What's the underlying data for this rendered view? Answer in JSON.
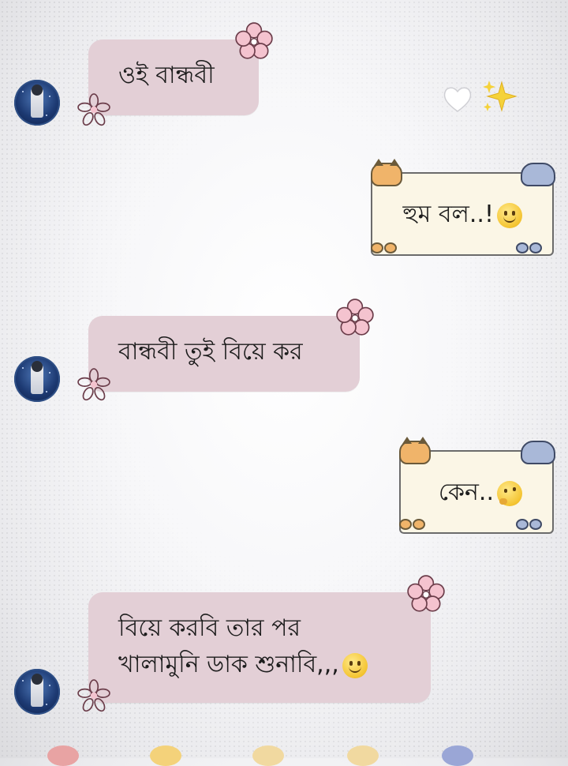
{
  "messages": [
    {
      "id": "m1",
      "side": "incoming",
      "text": "ওই বান্ধবী"
    },
    {
      "id": "m2",
      "side": "outgoing",
      "text": "হুম বল..!",
      "emoji": "slightly-smiling-face"
    },
    {
      "id": "m3",
      "side": "incoming",
      "text": "বান্ধবী তুই বিয়ে কর"
    },
    {
      "id": "m4",
      "side": "outgoing",
      "text": "কেন..",
      "emoji": "thinking-face"
    },
    {
      "id": "m5",
      "side": "incoming",
      "lines": [
        "বিয়ে করবি তার পর",
        "খালামুনি ডাক শুনাবি,,,"
      ],
      "emoji": "slightly-smiling-face"
    }
  ],
  "decorations": {
    "heart_icon": "white-heart-icon",
    "sparkles_icon": "sparkles-icon",
    "flower_icon": "pink-flower-icon",
    "sticker_cat": "cat-sticker-icon",
    "sticker_dog": "dog-sticker-icon"
  },
  "colors": {
    "incoming_bubble": "#e3cfd6",
    "note_paper": "#fbf6e6",
    "flower": "#e8a3b5",
    "accent_yellow": "#f2c830"
  }
}
